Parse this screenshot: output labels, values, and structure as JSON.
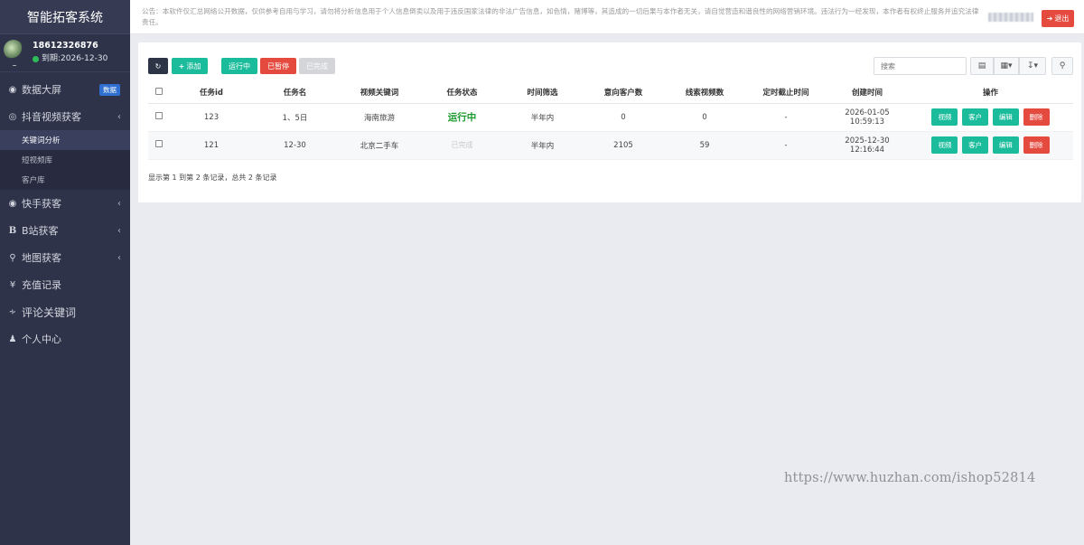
{
  "app": {
    "title": "智能拓客系统"
  },
  "user": {
    "phone": "18612326876",
    "expiry": "到期:2026-12-30"
  },
  "sidebar": {
    "items": [
      {
        "label": "数据大屏",
        "icon": "dashboard-icon",
        "badge": "数据"
      },
      {
        "label": "抖音视频获客",
        "icon": "eye-icon",
        "expanded": true,
        "children": [
          {
            "label": "关键词分析",
            "active": true
          },
          {
            "label": "短视频库"
          },
          {
            "label": "客户库"
          }
        ]
      },
      {
        "label": "快手获客",
        "icon": "play-circle-icon"
      },
      {
        "label": "B站获客",
        "icon": "bold-icon"
      },
      {
        "label": "地图获客",
        "icon": "map-marker-icon"
      },
      {
        "label": "充值记录",
        "icon": "yen-icon"
      },
      {
        "label": "评论关键词",
        "icon": "rss-icon"
      },
      {
        "label": "个人中心",
        "icon": "user-icon"
      }
    ]
  },
  "notice": {
    "text": "公告：本软件仅汇总网络公开数据，仅供参考自用与学习，请勿将分析信息用于个人信息倒卖以及用于违反国家法律的非法广告信息，如色情，赌博等，其造成的一切后果与本作者无关，请自觉营造和谐良性的网络营销环境。违法行为一经发现，本作者有权终止服务并追究法律责任。"
  },
  "header": {
    "logout_label": "退出"
  },
  "toolbar": {
    "add_label": "添加",
    "running_label": "运行中",
    "paused_label": "已暂停",
    "completed_label": "已完成",
    "search_placeholder": "搜索"
  },
  "table": {
    "columns": [
      "任务id",
      "任务名",
      "视频关键词",
      "任务状态",
      "时间筛选",
      "意向客户数",
      "线索视频数",
      "定时截止时间",
      "创建时间",
      "操作"
    ],
    "rows": [
      {
        "id": "123",
        "name": "1、5日",
        "keyword": "海南旅游",
        "status": "运行中",
        "time_filter": "半年内",
        "intent_customers": "0",
        "lead_videos": "0",
        "deadline": "-",
        "created": "2026-01-05 10:59:13"
      },
      {
        "id": "121",
        "name": "12-30",
        "keyword": "北京二手车",
        "status": "已完成",
        "time_filter": "半年内",
        "intent_customers": "2105",
        "lead_videos": "59",
        "deadline": "-",
        "created": "2025-12-30 12:16:44"
      }
    ],
    "actions": [
      "视频",
      "客户",
      "编辑",
      "删除"
    ],
    "summary": "显示第 1 到第 2 条记录，总共 2 条记录"
  },
  "watermark": "https://www.huzhan.com/ishop52814"
}
